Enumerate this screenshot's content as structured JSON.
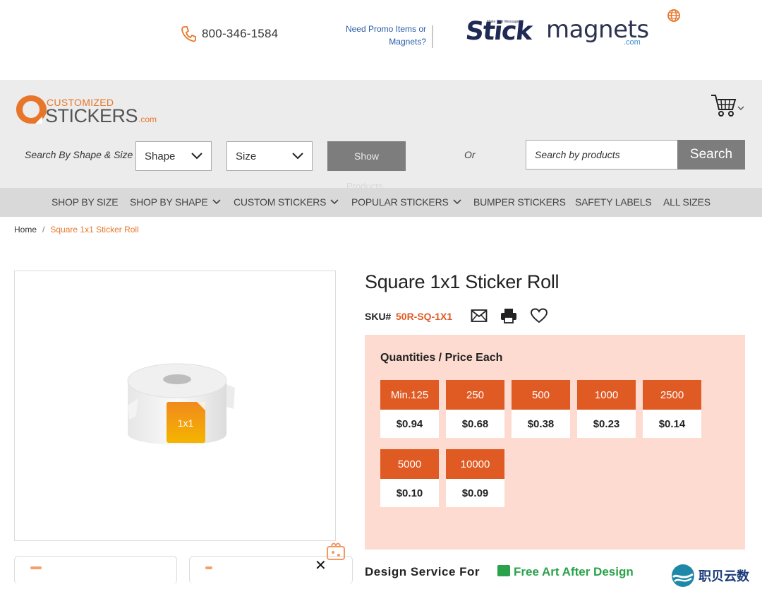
{
  "topbar": {
    "phone": "800-346-1584",
    "promo_line1": "Need Promo Items or",
    "promo_line2": "Magnets?",
    "stick_logo": "Stick",
    "stick_tagline": "Make Your Message",
    "magnets_logo": "magnets",
    "magnets_com": ".com"
  },
  "header": {
    "logo_top": "CUSTOMIZED",
    "logo_main": "STICKERS",
    "logo_com": ".com",
    "search_label": "Search By Shape & Size",
    "shape_select": "Shape",
    "size_select": "Size",
    "show_button_line1": "Show",
    "show_button_line2": "Products",
    "or_text": "Or",
    "search_placeholder": "Search by products",
    "search_button": "Search"
  },
  "nav": {
    "items": [
      {
        "label": "SHOP BY SIZE",
        "dropdown": false
      },
      {
        "label": "SHOP BY SHAPE",
        "dropdown": true
      },
      {
        "label": "CUSTOM STICKERS",
        "dropdown": true
      },
      {
        "label": "POPULAR STICKERS",
        "dropdown": true
      },
      {
        "label": "BUMPER STICKERS",
        "dropdown": false
      },
      {
        "label": "SAFETY LABELS",
        "dropdown": false
      },
      {
        "label": "ALL SIZES",
        "dropdown": false
      }
    ]
  },
  "breadcrumb": {
    "home": "Home",
    "separator": "/",
    "current": "Square 1x1 Sticker Roll"
  },
  "product": {
    "image_label": "1x1",
    "title": "Square 1x1 Sticker Roll",
    "sku_label": "SKU#",
    "sku_value": "50R-SQ-1X1"
  },
  "pricing": {
    "heading": "Quantities / Price Each",
    "tiers": [
      {
        "qty": "Min.125",
        "price": "$0.94"
      },
      {
        "qty": "250",
        "price": "$0.68"
      },
      {
        "qty": "500",
        "price": "$0.38"
      },
      {
        "qty": "1000",
        "price": "$0.23"
      },
      {
        "qty": "2500",
        "price": "$0.14"
      },
      {
        "qty": "5000",
        "price": "$0.10"
      },
      {
        "qty": "10000",
        "price": "$0.09"
      }
    ]
  },
  "below": {
    "design_partial": "Design Service For",
    "green_partial": "Free Art After Design"
  },
  "watermark": {
    "text": "职贝云数"
  },
  "colors": {
    "accent_orange": "#e05a23",
    "logo_orange": "#e8762a",
    "price_panel_bg": "#fddbd0",
    "header_gray": "#ececec",
    "nav_gray": "#d9d9d9"
  }
}
